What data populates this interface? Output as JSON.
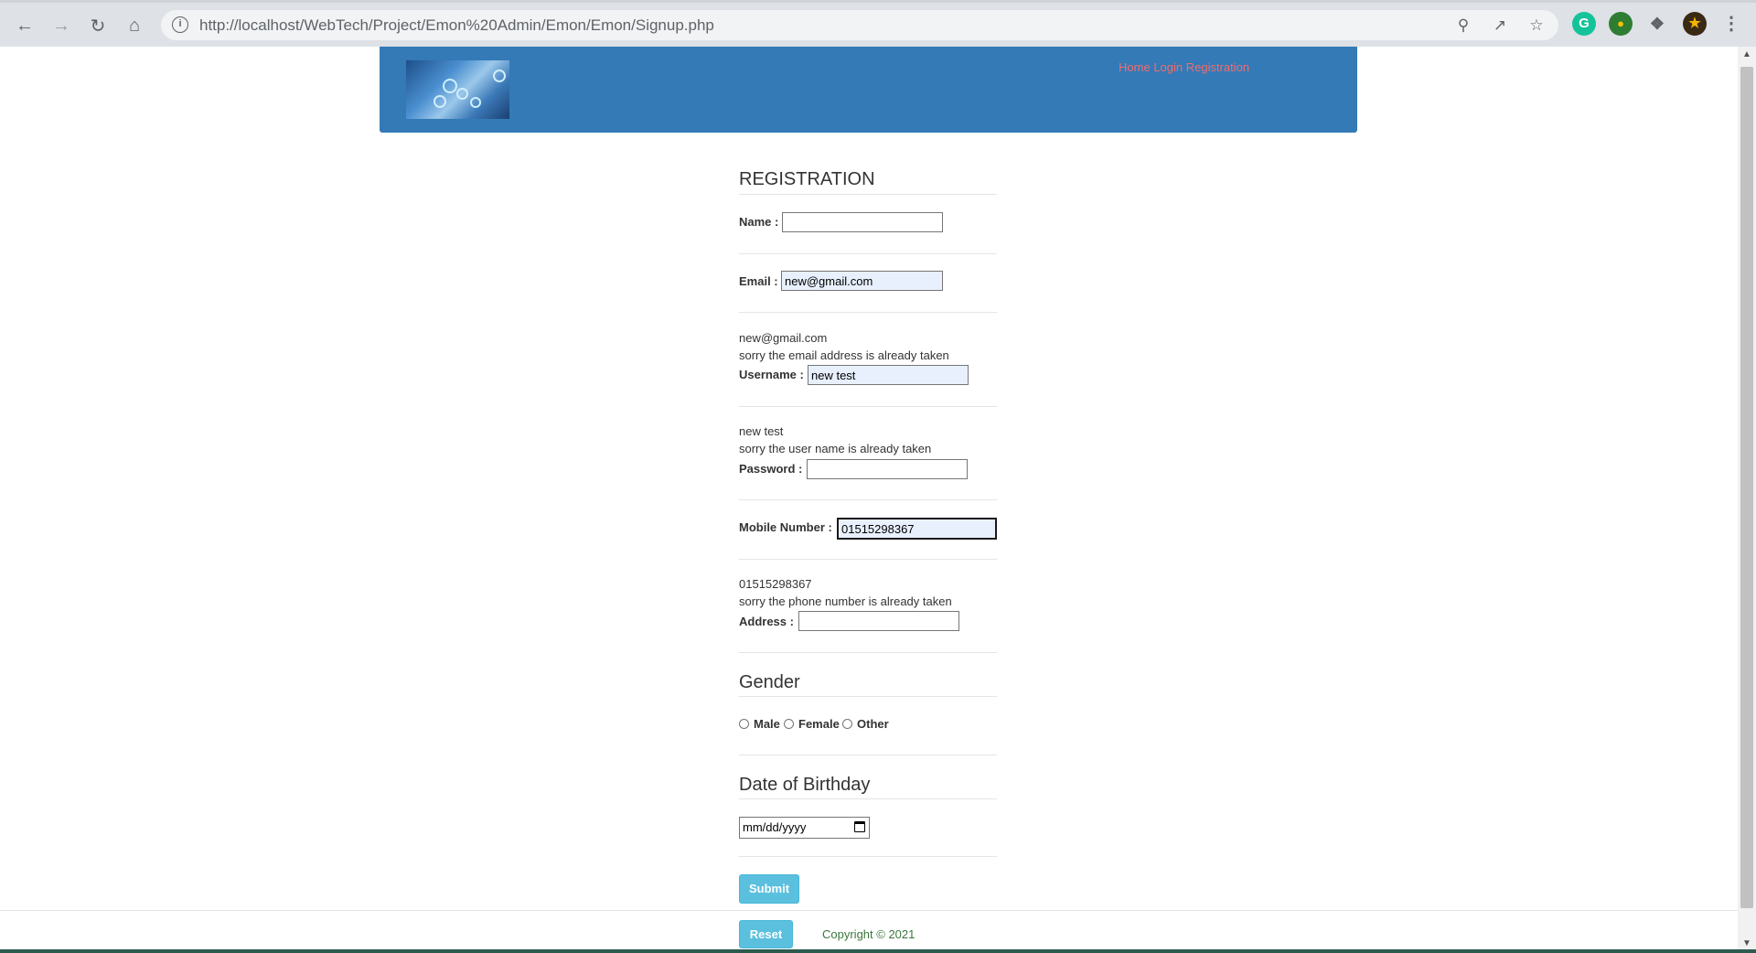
{
  "browser": {
    "url": "http://localhost/WebTech/Project/Emon%20Admin/Emon/Emon/Signup.php",
    "icons": [
      "back-icon",
      "forward-icon",
      "reload-icon",
      "home-icon",
      "info-icon",
      "zoom-icon",
      "share-icon",
      "star-icon",
      "grammarly-icon",
      "extension-icon",
      "puzzle-icon",
      "profile-avatar",
      "menu-icon"
    ]
  },
  "header": {
    "nav": {
      "home": "Home",
      "login": "Login",
      "registration": "Registration"
    }
  },
  "form": {
    "title": "REGISTRATION",
    "name": {
      "label": "Name :",
      "value": ""
    },
    "email": {
      "label": "Email :",
      "value": "new@gmail.com"
    },
    "email_echo": "new@gmail.com",
    "email_error": "sorry the email address is already taken",
    "username": {
      "label": "Username :",
      "value": "new test"
    },
    "username_echo": "new test",
    "username_error": "sorry the user name is already taken",
    "password": {
      "label": "Password :",
      "value": ""
    },
    "mobile": {
      "label": "Mobile Number :",
      "value": "01515298367"
    },
    "mobile_echo": "01515298367",
    "mobile_error": "sorry the phone number is already taken",
    "address": {
      "label": "Address :",
      "value": ""
    },
    "gender": {
      "title": "Gender",
      "options": [
        "Male",
        "Female",
        "Other"
      ]
    },
    "dob": {
      "title": "Date of Birthday",
      "placeholder": "mm/dd/yyyy"
    },
    "submit": "Submit",
    "reset": "Reset"
  },
  "footer": {
    "copyright": "Copyright © 2021"
  },
  "colors": {
    "header_bg": "#337ab7",
    "nav_link": "#f36b6b",
    "button_bg": "#5bc0de",
    "copyright": "#3c763d"
  }
}
